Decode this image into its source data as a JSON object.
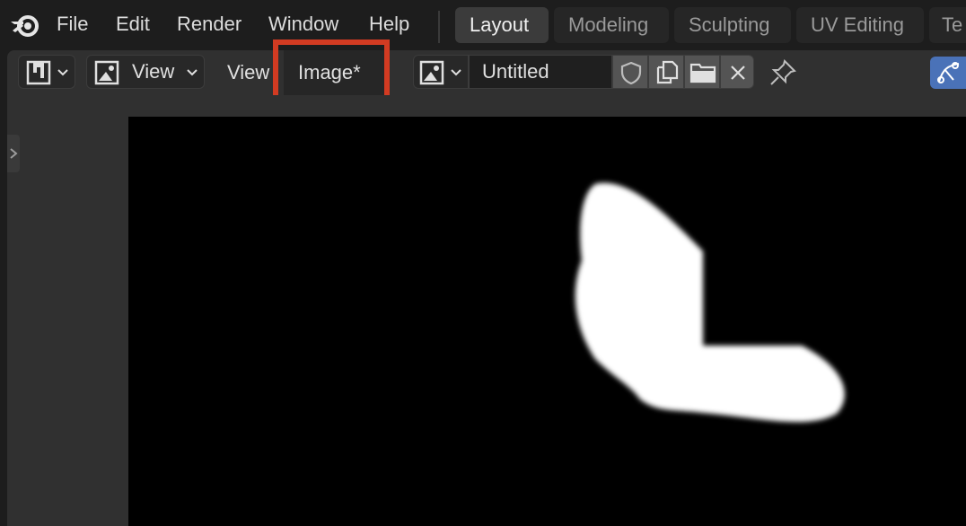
{
  "menu": {
    "file": "File",
    "edit": "Edit",
    "render": "Render",
    "window": "Window",
    "help": "Help"
  },
  "workspaces": [
    "Layout",
    "Modeling",
    "Sculpting",
    "UV Editing",
    "Te"
  ],
  "header": {
    "editor_type_icon": "paint-editor-icon",
    "mode_label": "View",
    "view_menu": "View",
    "image_menu": "Image*",
    "image_name": "Untitled"
  },
  "icons": {
    "app": "blender-logo-icon",
    "image": "image-icon",
    "fake_user": "shield-icon",
    "new_image": "duplicate-icon",
    "open_image": "folder-icon",
    "unlink": "close-icon",
    "pin": "pin-icon",
    "gizmo": "gizmo-icon"
  },
  "colors": {
    "highlight": "#d23b22",
    "gizmo_active": "#4a72b8"
  }
}
